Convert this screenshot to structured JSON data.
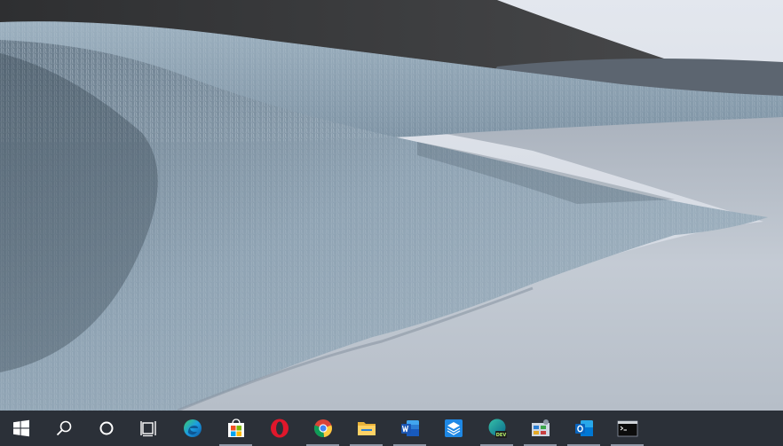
{
  "desktop": {
    "wallpaper": "windows-10-lake-grass-hills",
    "colors": {
      "sky": "#d9dee7",
      "hill": "#3b3c3e",
      "grass": "#8fa3b3",
      "water": "#b8c0ca"
    }
  },
  "taskbar": {
    "background": "#2b3038",
    "system_buttons": [
      {
        "name": "start-button",
        "icon": "windows-logo-icon"
      },
      {
        "name": "search-button",
        "icon": "search-icon"
      },
      {
        "name": "cortana-button",
        "icon": "cortana-circle-icon"
      },
      {
        "name": "task-view-button",
        "icon": "task-view-icon"
      }
    ],
    "apps": [
      {
        "name": "microsoft-edge",
        "icon": "edge-icon",
        "running": false
      },
      {
        "name": "microsoft-store",
        "icon": "store-icon",
        "running": true
      },
      {
        "name": "opera",
        "icon": "opera-icon",
        "running": false
      },
      {
        "name": "google-chrome",
        "icon": "chrome-icon",
        "running": true
      },
      {
        "name": "file-explorer",
        "icon": "folder-icon",
        "running": true
      },
      {
        "name": "microsoft-word",
        "icon": "word-icon",
        "running": true
      },
      {
        "name": "sandbox-app",
        "icon": "sandbox-box-icon",
        "running": false
      },
      {
        "name": "microsoft-edge-dev",
        "icon": "edge-dev-icon",
        "running": true
      },
      {
        "name": "control-panel",
        "icon": "control-panel-icon",
        "running": true
      },
      {
        "name": "microsoft-outlook",
        "icon": "outlook-icon",
        "running": true
      },
      {
        "name": "command-prompt",
        "icon": "terminal-icon",
        "running": true
      }
    ]
  }
}
